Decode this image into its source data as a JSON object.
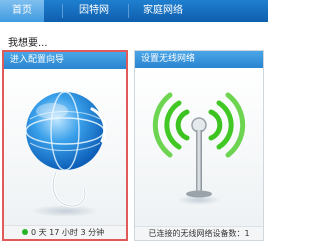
{
  "tabs": [
    {
      "label": "首页",
      "active": true
    },
    {
      "label": "因特网",
      "active": false
    },
    {
      "label": "家庭网络",
      "active": false
    }
  ],
  "intro_text": "我想要...",
  "cards": {
    "wizard": {
      "title": "进入配置向导",
      "uptime": "0 天 17 小时 3 分钟",
      "status_color": "#28b428",
      "icon": "globe-icon"
    },
    "wireless": {
      "title": "设置无线网络",
      "devices_label": "已连接的无线网络设备数：",
      "devices_count": "1",
      "icon": "wifi-antenna-icon"
    }
  },
  "colors": {
    "accent": "#1f7fcf",
    "selected_border": "#e05a5a",
    "signal_green": "#3cc31f"
  }
}
